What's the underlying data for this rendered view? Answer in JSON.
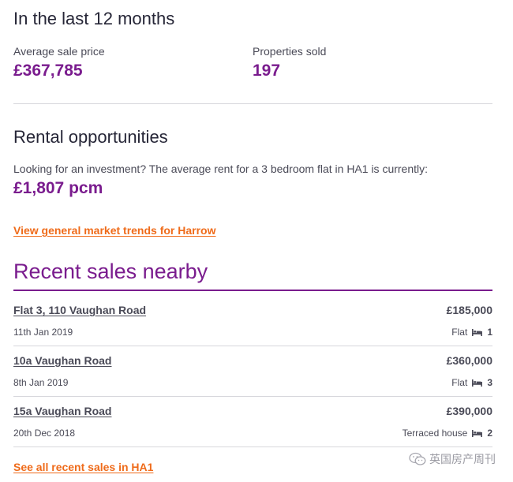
{
  "last12": {
    "title": "In the last 12 months",
    "avg_label": "Average sale price",
    "avg_value": "£367,785",
    "sold_label": "Properties sold",
    "sold_value": "197"
  },
  "rental": {
    "title": "Rental opportunities",
    "text": "Looking for an investment? The average rent for a 3 bedroom flat in HA1 is currently:",
    "value": "£1,807 pcm",
    "link": "View general market trends for Harrow"
  },
  "recent": {
    "title": "Recent sales nearby",
    "sales": [
      {
        "address": "Flat 3, 110 Vaughan Road",
        "price": "£185,000",
        "date": "11th Jan 2019",
        "type": "Flat",
        "beds": "1"
      },
      {
        "address": "10a Vaughan Road",
        "price": "£360,000",
        "date": "8th Jan 2019",
        "type": "Flat",
        "beds": "3"
      },
      {
        "address": "15a Vaughan Road",
        "price": "£390,000",
        "date": "20th Dec 2018",
        "type": "Terraced house",
        "beds": "2"
      }
    ],
    "see_all": "See all recent sales in HA1"
  },
  "watermark": {
    "text": "英国房产周刊",
    "icon": "wechat-icon"
  },
  "colors": {
    "accent_purple": "#7a1c8e",
    "link_orange": "#ef6b1a",
    "text_dark": "#262637",
    "divider": "#d7d7dc"
  }
}
